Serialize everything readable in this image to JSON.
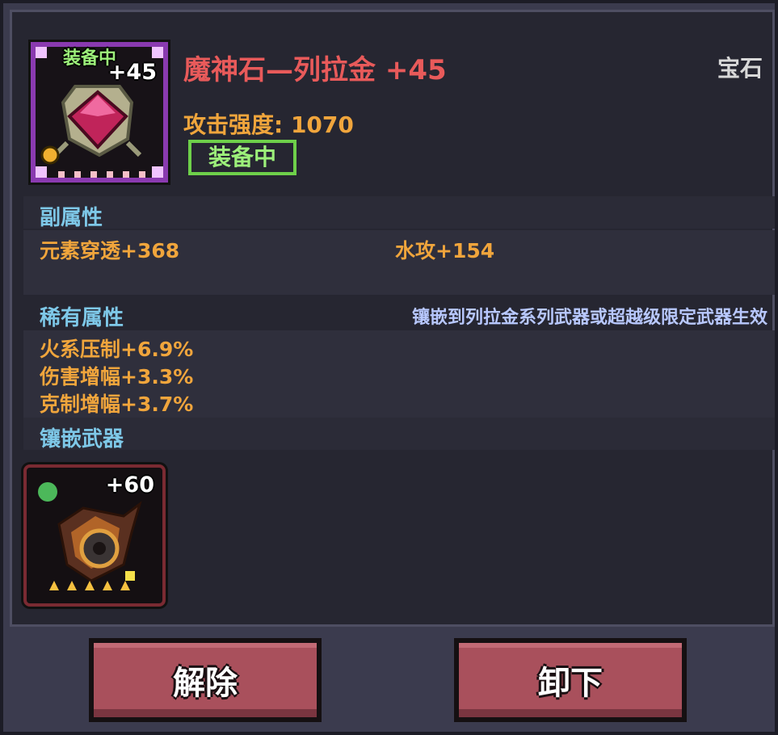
{
  "item": {
    "name": "魔神石—列拉金 +45",
    "category": "宝石",
    "equipped_tag": "装备中",
    "level_badge": "+45",
    "attack_line": "攻击强度: 1070",
    "equipped_badge": "装备中"
  },
  "sections": {
    "secondary": {
      "title": "副属性",
      "stats": [
        "元素穿透+368",
        "水攻+154"
      ]
    },
    "rare": {
      "title": "稀有属性",
      "note": "镶嵌到列拉金系列武器或超越级限定武器生效",
      "stats": [
        "火系压制+6.9%",
        "伤害增幅+3.3%",
        "克制增幅+3.7%"
      ]
    },
    "socket": {
      "title": "镶嵌武器",
      "weapon_level": "+60"
    }
  },
  "buttons": {
    "remove": "解除",
    "unequip": "卸下"
  },
  "colors": {
    "name": "#e85a5a",
    "stat": "#f0a53c",
    "section_title": "#7ec8e8",
    "note": "#b8c8ff",
    "equipped": "#9cf07a",
    "category": "#d8d8d8"
  }
}
